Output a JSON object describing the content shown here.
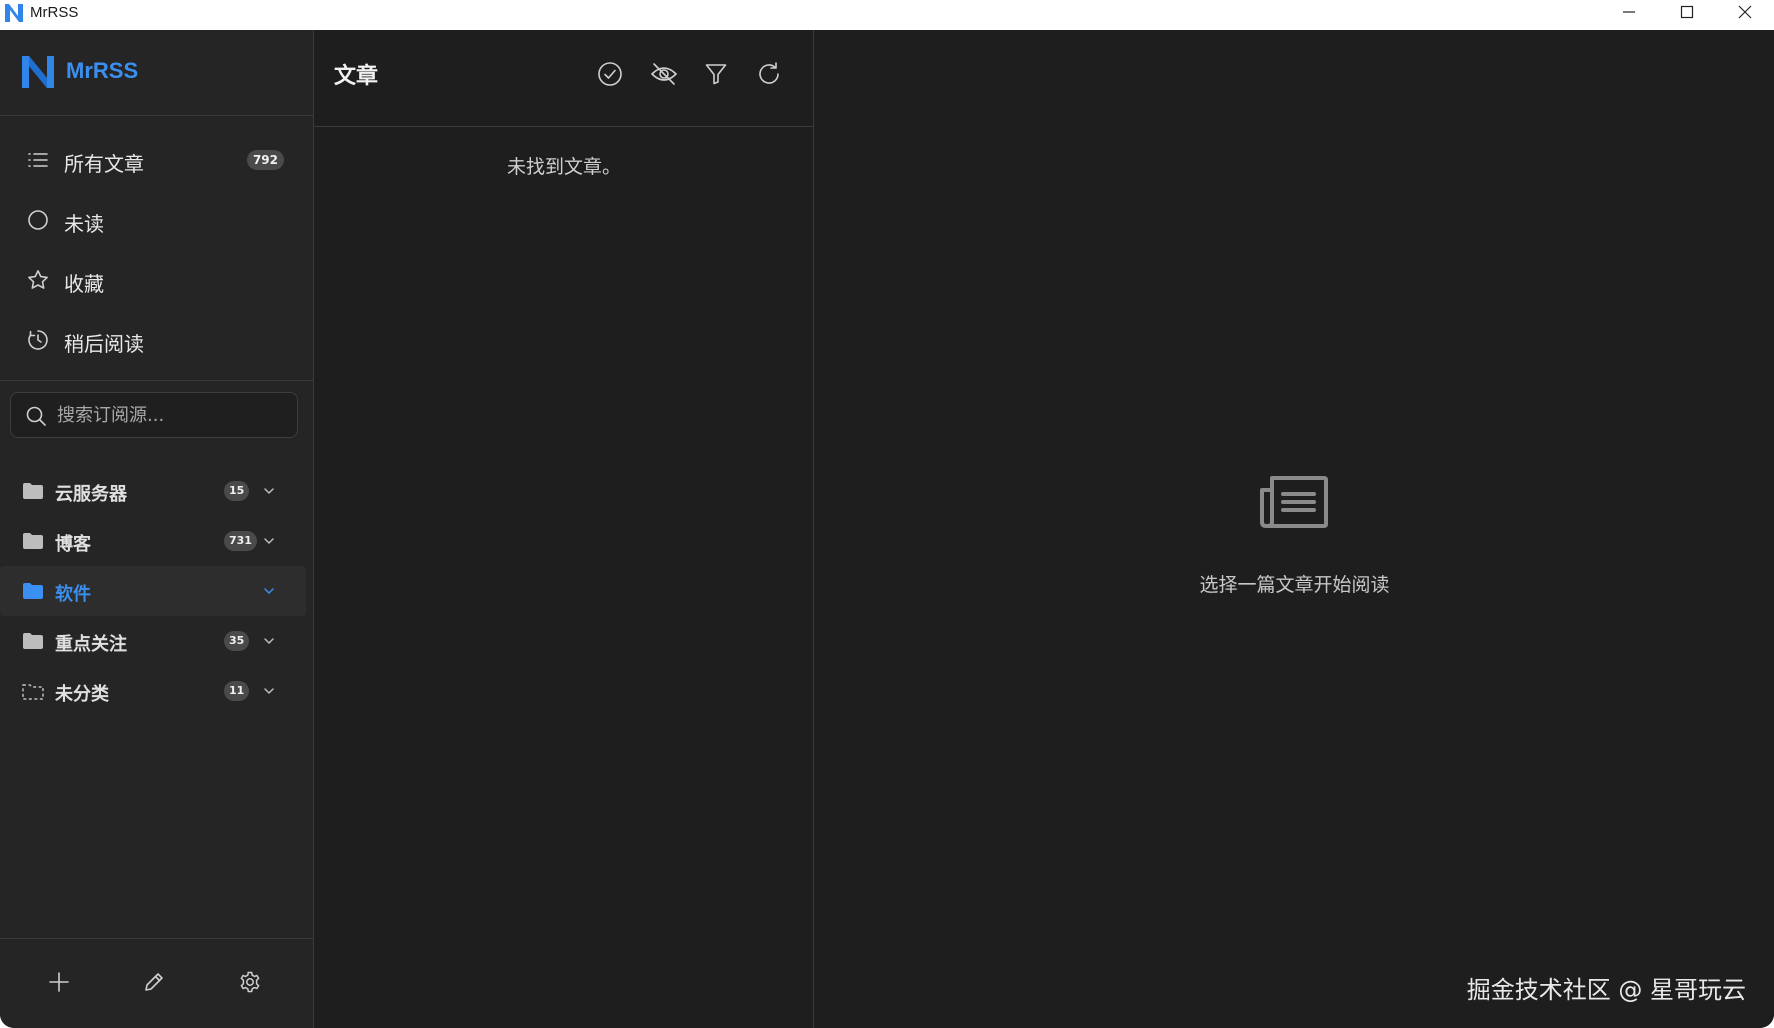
{
  "window": {
    "title": "MrRSS",
    "controls": [
      "minimize-icon",
      "maximize-icon",
      "close-icon"
    ]
  },
  "sidebar": {
    "brand": "MrRSS",
    "brand_color": "#3b8ff0",
    "nav": [
      {
        "label": "所有文章",
        "icon": "list-icon",
        "count": "792"
      },
      {
        "label": "未读",
        "icon": "circle-icon",
        "count": ""
      },
      {
        "label": "收藏",
        "icon": "star-icon",
        "count": ""
      },
      {
        "label": "稍后阅读",
        "icon": "clock-icon",
        "count": ""
      }
    ],
    "search": {
      "placeholder": "搜索订阅源..."
    },
    "folders": [
      {
        "label": "云服务器",
        "count": "15",
        "active": false
      },
      {
        "label": "博客",
        "count": "731",
        "active": false
      },
      {
        "label": "软件",
        "count": "",
        "active": true
      },
      {
        "label": "重点关注",
        "count": "35",
        "active": false
      },
      {
        "label": "未分类",
        "count": "11",
        "active": false
      }
    ],
    "bottom_actions": [
      "add-icon",
      "edit-icon",
      "settings-icon"
    ]
  },
  "article_list": {
    "title": "文章",
    "actions": [
      "mark-all-read-icon",
      "hide-read-icon",
      "filter-icon",
      "refresh-icon"
    ],
    "empty_message": "未找到文章。"
  },
  "reader": {
    "icon": "newspaper-icon",
    "empty_message": "选择一篇文章开始阅读"
  },
  "watermark": "掘金技术社区 @ 星哥玩云"
}
